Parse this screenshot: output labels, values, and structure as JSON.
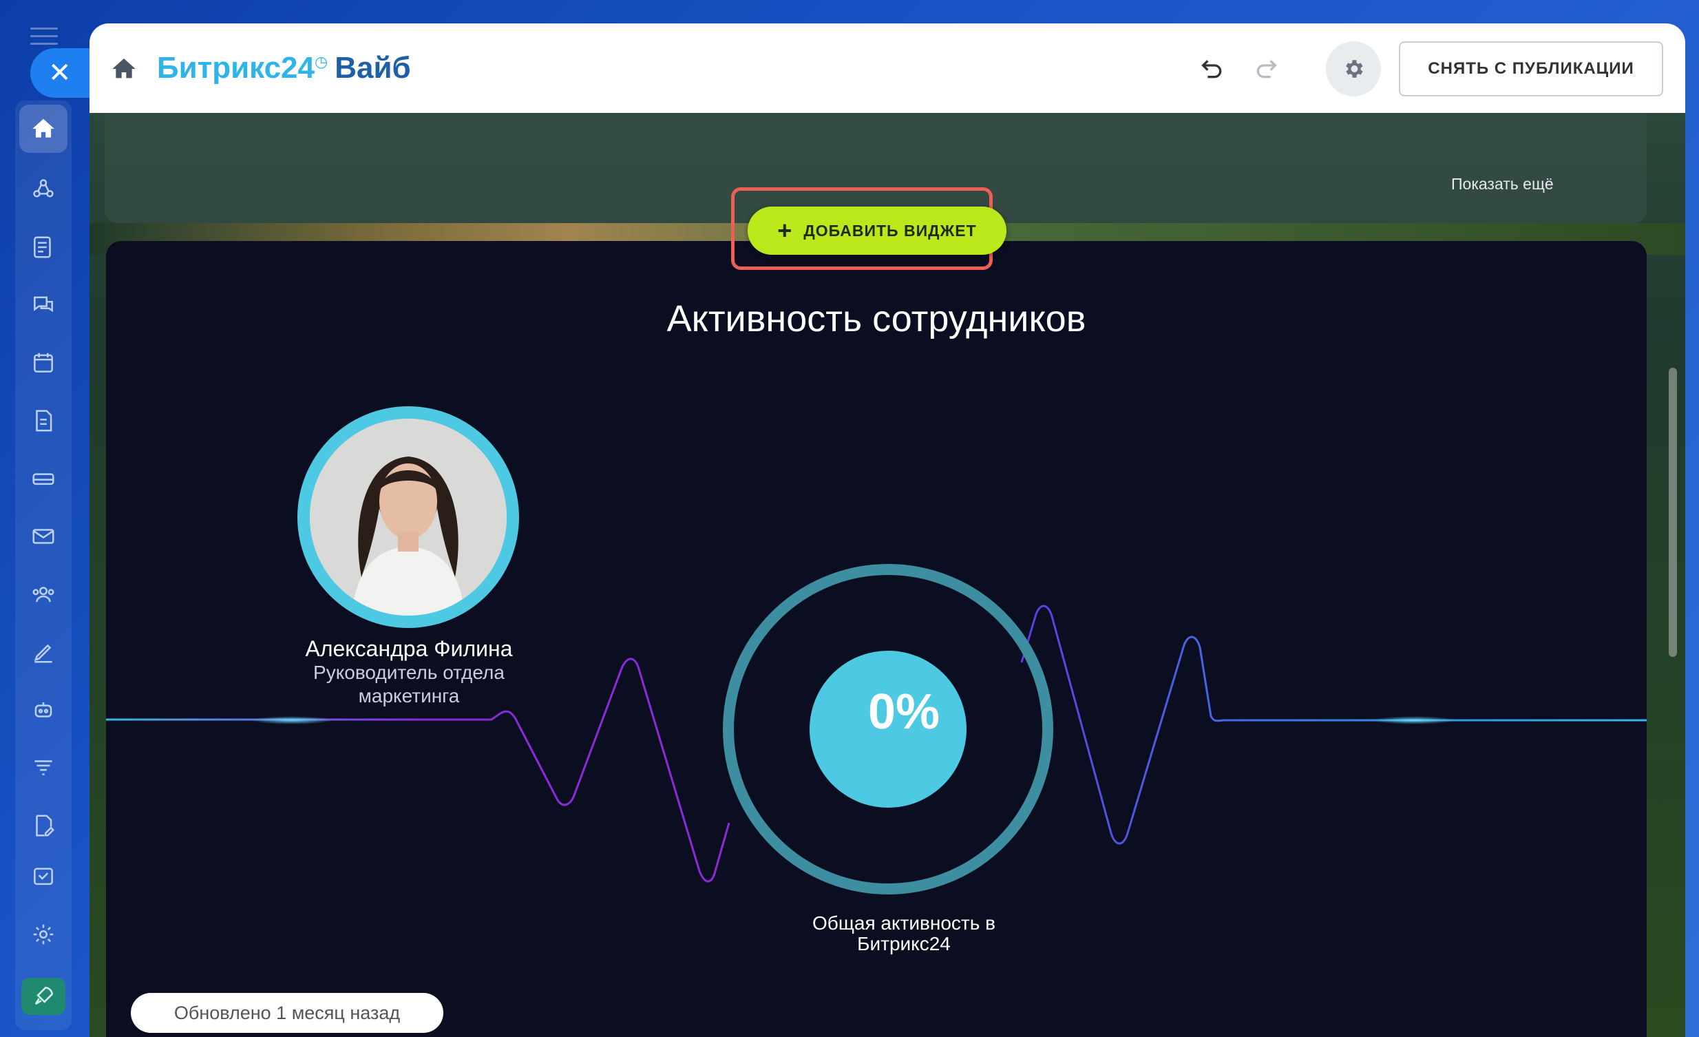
{
  "sidebar": {
    "close_label": "✕",
    "items": [
      {
        "icon": "home-icon",
        "active": true
      },
      {
        "icon": "collab-icon"
      },
      {
        "icon": "feed-icon"
      },
      {
        "icon": "chat-icon"
      },
      {
        "icon": "calendar-icon"
      },
      {
        "icon": "document-icon"
      },
      {
        "icon": "storage-icon"
      },
      {
        "icon": "mail-icon"
      },
      {
        "icon": "users-icon"
      },
      {
        "icon": "pen-icon"
      },
      {
        "icon": "robot-icon"
      },
      {
        "icon": "funnel-icon"
      },
      {
        "icon": "sign-document-icon"
      },
      {
        "icon": "tasks-icon"
      },
      {
        "icon": "settings-icon"
      },
      {
        "icon": "rocket-icon"
      }
    ]
  },
  "header": {
    "brand_part1": "Битрикс24",
    "brand_clock": "◷",
    "brand_part2": "Вайб",
    "unpublish_label": "СНЯТЬ С ПУБЛИКАЦИИ"
  },
  "upper_widget": {
    "show_more": "Показать ещё"
  },
  "add_widget": {
    "plus": "+",
    "label": "ДОБАВИТЬ ВИДЖЕТ"
  },
  "activity": {
    "title": "Активность сотрудников",
    "person_name": "Александра Филина",
    "person_role": "Руководитель отдела маркетинга",
    "percent": "0%",
    "total_label": "Общая активность в Битрикс24",
    "updated": "Обновлено 1 месяц назад"
  },
  "colors": {
    "accent_green": "#bbe81a",
    "highlight_red": "#ef5d57",
    "ring_teal": "#4ec9e3",
    "widget_bg": "#0a0e20"
  }
}
